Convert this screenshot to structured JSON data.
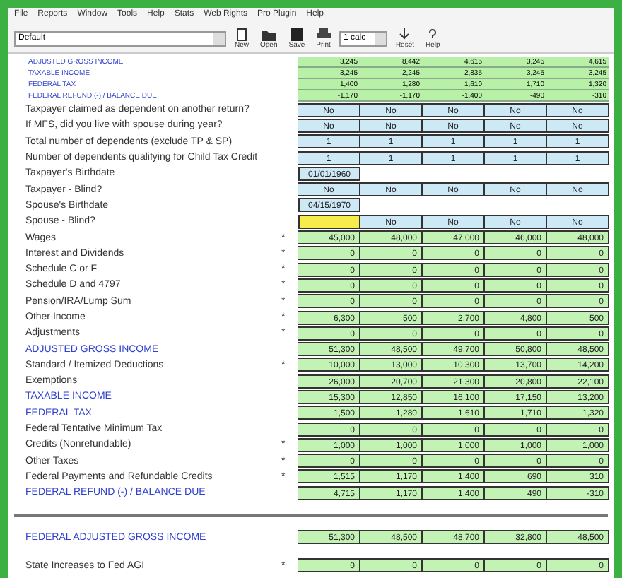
{
  "menu": [
    "File",
    "Reports",
    "Window",
    "Tools",
    "Help",
    "Stats",
    "Web Rights",
    "Pro Plugin",
    "Help"
  ],
  "toolbar": {
    "dropdown": "Default",
    "buttons": [
      "New",
      "Open",
      "Save",
      "Print"
    ],
    "select": "1 calc",
    "buttons2": [
      "Reset",
      "Help"
    ]
  },
  "summary": [
    {
      "label": "ADJUSTED GROSS INCOME",
      "values": [
        "3,245",
        "8,442",
        "4,615",
        "3,245",
        "4,615"
      ]
    },
    {
      "label": "TAXABLE INCOME",
      "values": [
        "3,245",
        "2,245",
        "2,835",
        "3,245",
        "3,245"
      ]
    },
    {
      "label": "FEDERAL TAX",
      "values": [
        "1,400",
        "1,280",
        "1,610",
        "1,710",
        "1,320"
      ]
    },
    {
      "label": "FEDERAL REFUND (-) / BALANCE DUE",
      "values": [
        "-1,170",
        "-1,170",
        "-1,400",
        "-490",
        "-310"
      ]
    }
  ],
  "rows": [
    {
      "kind": "choice",
      "label": "Taxpayer claimed as dependent on another return?",
      "values": [
        "No",
        "No",
        "No",
        "No",
        "No"
      ]
    },
    {
      "kind": "choice",
      "label": "If MFS, did you live with spouse during year?",
      "values": [
        "No",
        "No",
        "No",
        "No",
        "No"
      ]
    },
    {
      "kind": "choice",
      "label": "Total number of dependents (exclude TP & SP)",
      "values": [
        "1",
        "1",
        "1",
        "1",
        "1"
      ]
    },
    {
      "kind": "choice",
      "label": "Number of dependents qualifying for Child Tax Credit",
      "values": [
        "1",
        "1",
        "1",
        "1",
        "1"
      ]
    },
    {
      "kind": "date",
      "label": "Taxpayer's Birthdate",
      "values": [
        "01/01/1960"
      ]
    },
    {
      "kind": "choice",
      "label": "Taxpayer - Blind?",
      "values": [
        "No",
        "No",
        "No",
        "No",
        "No"
      ]
    },
    {
      "kind": "date",
      "label": "Spouse's Birthdate",
      "values": [
        "04/15/1970"
      ]
    },
    {
      "kind": "choice",
      "label": "Spouse - Blind?",
      "cursor": true,
      "values": [
        "No",
        "No",
        "No",
        "No"
      ]
    },
    {
      "kind": "amount",
      "label": "Wages",
      "mark": "*",
      "values": [
        "45,000",
        "48,000",
        "47,000",
        "46,000",
        "48,000"
      ]
    },
    {
      "kind": "amount",
      "label": "Interest and Dividends",
      "mark": "*",
      "values": [
        "0",
        "0",
        "0",
        "0",
        "0"
      ]
    },
    {
      "kind": "amount",
      "label": "Schedule C or F",
      "mark": "*",
      "values": [
        "0",
        "0",
        "0",
        "0",
        "0"
      ]
    },
    {
      "kind": "amount",
      "label": "Schedule D and 4797",
      "mark": "*",
      "values": [
        "0",
        "0",
        "0",
        "0",
        "0"
      ]
    },
    {
      "kind": "amount",
      "label": "Pension/IRA/Lump Sum",
      "mark": "*",
      "values": [
        "0",
        "0",
        "0",
        "0",
        "0"
      ]
    },
    {
      "kind": "amount",
      "label": "Other Income",
      "mark": "*",
      "values": [
        "6,300",
        "500",
        "2,700",
        "4,800",
        "500"
      ]
    },
    {
      "kind": "amount",
      "label": "Adjustments",
      "mark": "*",
      "values": [
        "0",
        "0",
        "0",
        "0",
        "0"
      ]
    },
    {
      "kind": "total",
      "label": "ADJUSTED GROSS INCOME",
      "values": [
        "51,300",
        "48,500",
        "49,700",
        "50,800",
        "48,500"
      ]
    },
    {
      "kind": "amount",
      "label": "Standard / Itemized Deductions",
      "mark": "*",
      "values": [
        "10,000",
        "13,000",
        "10,300",
        "13,700",
        "14,200"
      ]
    },
    {
      "kind": "amount",
      "label": "Exemptions",
      "values": [
        "26,000",
        "20,700",
        "21,300",
        "20,800",
        "22,100"
      ]
    },
    {
      "kind": "total",
      "label": "TAXABLE INCOME",
      "values": [
        "15,300",
        "12,850",
        "16,100",
        "17,150",
        "13,200"
      ]
    },
    {
      "kind": "total",
      "label": "FEDERAL TAX",
      "values": [
        "1,500",
        "1,280",
        "1,610",
        "1,710",
        "1,320"
      ]
    },
    {
      "kind": "amount",
      "label": "Federal Tentative Minimum Tax",
      "values": [
        "0",
        "0",
        "0",
        "0",
        "0"
      ]
    },
    {
      "kind": "amount",
      "label": "Credits (Nonrefundable)",
      "mark": "*",
      "values": [
        "1,000",
        "1,000",
        "1,000",
        "1,000",
        "1,000"
      ]
    },
    {
      "kind": "amount",
      "label": "Other Taxes",
      "mark": "*",
      "values": [
        "0",
        "0",
        "0",
        "0",
        "0"
      ]
    },
    {
      "kind": "amount",
      "label": "Federal Payments and Refundable Credits",
      "mark": "*",
      "values": [
        "1,515",
        "1,170",
        "1,400",
        "690",
        "310"
      ]
    },
    {
      "kind": "total",
      "label": "FEDERAL REFUND (-) / BALANCE DUE",
      "values": [
        "4,715",
        "1,170",
        "1,400",
        "490",
        "-310"
      ]
    }
  ],
  "state_rows": [
    {
      "kind": "total",
      "label": "FEDERAL ADJUSTED GROSS INCOME",
      "values": [
        "51,300",
        "48,500",
        "48,700",
        "32,800",
        "48,500"
      ]
    },
    {
      "kind": "amount",
      "label": "State Increases to Fed AGI",
      "mark": "*",
      "values": [
        "0",
        "0",
        "0",
        "0",
        "0"
      ]
    }
  ]
}
